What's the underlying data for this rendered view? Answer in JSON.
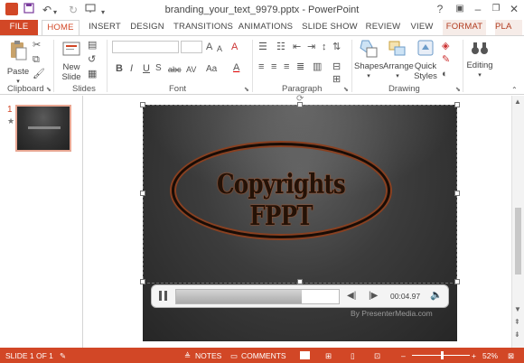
{
  "window": {
    "title": "branding_your_text_9979.pptx - PowerPoint",
    "help": "?",
    "minimize": "–",
    "restore": "❐",
    "close": "✕"
  },
  "quick_access": {
    "save_icon": "save-icon",
    "undo_icon": "undo-icon",
    "redo_icon": "redo-icon",
    "present_icon": "start-from-beginning-icon"
  },
  "tabs": [
    "FILE",
    "HOME",
    "INSERT",
    "DESIGN",
    "TRANSITIONS",
    "ANIMATIONS",
    "SLIDE SHOW",
    "REVIEW",
    "VIEW",
    "FORMAT",
    "PLA"
  ],
  "active_tab": "HOME",
  "ribbon": {
    "clipboard": {
      "label": "Clipboard",
      "paste": "Paste"
    },
    "slides": {
      "label": "Slides",
      "new_slide_1": "New",
      "new_slide_2": "Slide"
    },
    "font": {
      "label": "Font",
      "bold": "B",
      "italic": "I",
      "underline": "U",
      "strike": "S",
      "shadow": "abc",
      "spacing": "AV",
      "case": "Aa",
      "grow": "A",
      "shrink": "A",
      "clear": "A",
      "color": "A"
    },
    "paragraph": {
      "label": "Paragraph"
    },
    "drawing": {
      "label": "Drawing",
      "shapes": "Shapes",
      "arrange": "Arrange",
      "quick_styles_1": "Quick",
      "quick_styles_2": "Styles"
    },
    "editing": {
      "label": "Editing"
    }
  },
  "thumbnails": [
    {
      "number": "1",
      "star": "★"
    }
  ],
  "slide": {
    "title": "Copyrights  FPPT"
  },
  "media": {
    "time": "00:04.97",
    "progress": 0.77
  },
  "watermark": "By PresenterMedia.com",
  "status": {
    "slide_of": "SLIDE 1 OF 1",
    "notes": "NOTES",
    "comments": "COMMENTS",
    "zoom": "52%",
    "zoom_fraction": 0.52
  },
  "colors": {
    "accent": "#d24726"
  }
}
